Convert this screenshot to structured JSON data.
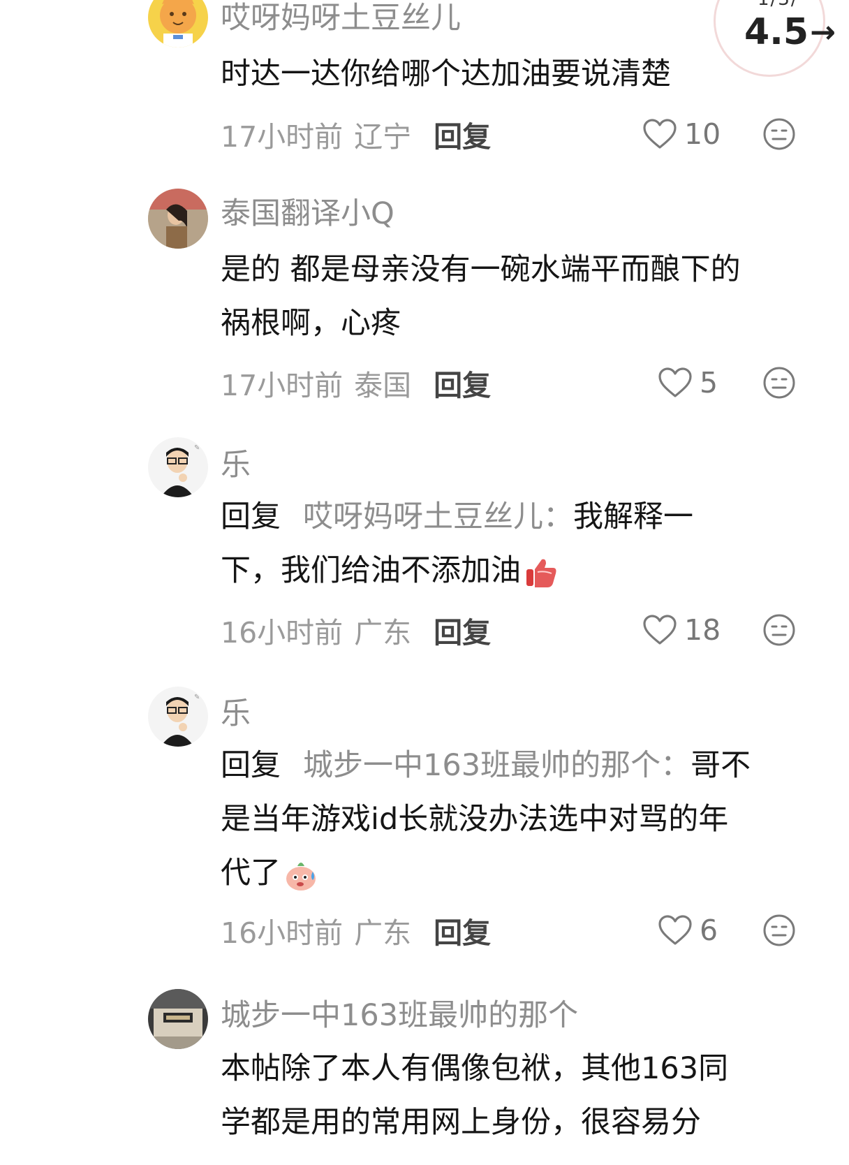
{
  "score": {
    "top_partial": "1/3/",
    "value": "4.5"
  },
  "comments": [
    {
      "username": "哎呀妈呀土豆丝儿",
      "lines": [
        "时达一达你给哪个达加油要说清楚"
      ],
      "time": "17小时前",
      "location": "辽宁",
      "reply_label": "回复",
      "likes": "10"
    },
    {
      "username": "泰国翻译小Q",
      "lines": [
        "是的 都是母亲没有一碗水端平而酿下的",
        "祸根啊，心疼"
      ],
      "time": "17小时前",
      "location": "泰国",
      "reply_label": "回复",
      "likes": "5"
    },
    {
      "username": "乐",
      "reply_prefix": "回复",
      "reply_target": "哎呀妈呀土豆丝儿：",
      "line1_rest": "我解释一",
      "line2": "下，我们给油不添加油",
      "emoji": "thumbs-up-emoji",
      "time": "16小时前",
      "location": "广东",
      "reply_label": "回复",
      "likes": "18"
    },
    {
      "username": "乐",
      "reply_prefix": "回复",
      "reply_target": "城步一中163班最帅的那个：",
      "line1_rest": "哥不",
      "line2": "是当年游戏id长就没办法选中对骂的年",
      "line3": "代了",
      "emoji": "sweat-smile-emoji",
      "time": "16小时前",
      "location": "广东",
      "reply_label": "回复",
      "likes": "6"
    },
    {
      "username": "城步一中163班最帅的那个",
      "lines": [
        "本帖除了本人有偶像包袱，其他163同",
        "学都是用的常用网上身份，很容易分"
      ]
    }
  ],
  "icons": {
    "like": "heart-outline-icon",
    "dislike": "meh-face-icon"
  }
}
